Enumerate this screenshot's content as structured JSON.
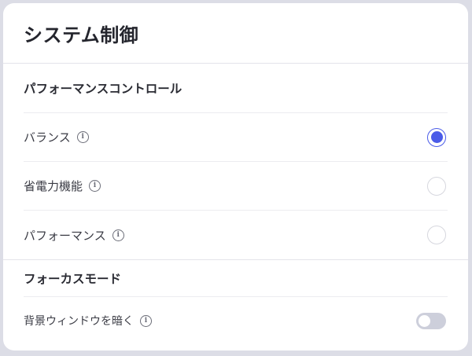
{
  "header": {
    "title": "システム制御"
  },
  "performance": {
    "heading": "パフォーマンスコントロール",
    "options": [
      {
        "label": "バランス",
        "selected": true
      },
      {
        "label": "省電力機能",
        "selected": false
      },
      {
        "label": "パフォーマンス",
        "selected": false
      }
    ],
    "info_icon": "i"
  },
  "focus": {
    "heading": "フォーカスモード",
    "dim_background": {
      "label": "背景ウィンドウを暗く",
      "enabled": false
    }
  },
  "colors": {
    "accent": "#4a5be8",
    "toggle_off": "#cdcfdb",
    "background": "#dcdde6"
  }
}
